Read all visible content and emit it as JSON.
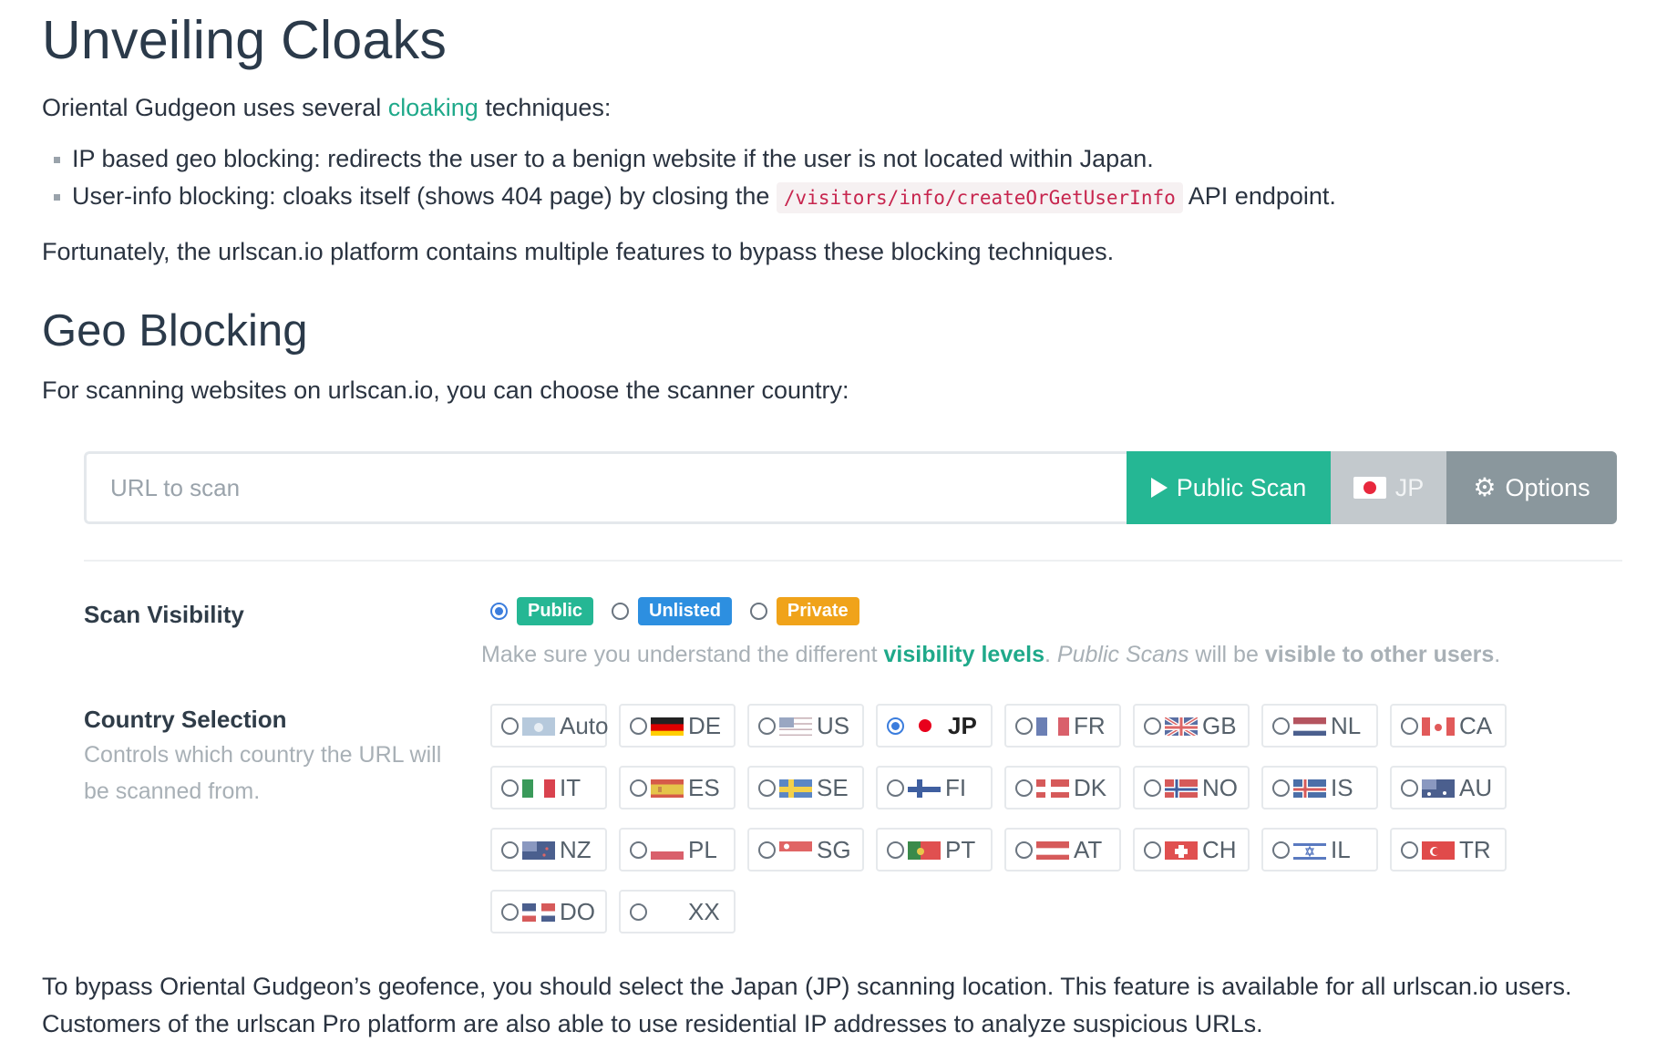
{
  "article": {
    "title": "Unveiling Cloaks",
    "intro_prefix": "Oriental Gudgeon uses several",
    "intro_link": "cloaking",
    "intro_suffix": "techniques:",
    "bullets": [
      {
        "text": "IP based geo blocking: redirects the user to a benign website if the user is not located within Japan."
      },
      {
        "prefix": "User-info blocking: cloaks itself (shows 404 page) by closing the",
        "code": "/visitors/info/createOrGetUserInfo",
        "suffix": "API endpoint."
      }
    ],
    "fortunately": "Fortunately, the urlscan.io platform contains multiple features to bypass these blocking techniques.",
    "section2_title": "Geo Blocking",
    "section2_intro": "For scanning websites on urlscan.io, you can choose the scanner country:",
    "closing_line1": "To bypass Oriental Gudgeon’s geofence, you should select the Japan (JP) scanning location. This feature is available for all urlscan.io users.",
    "closing_line2": "Customers of the urlscan Pro platform are also able to use residential IP addresses to analyze suspicious URLs."
  },
  "scanbar": {
    "placeholder": "URL to scan",
    "public_scan_label": "Public Scan",
    "country_label": "JP",
    "options_label": "Options",
    "icons": {
      "public_scan": "play-icon",
      "country": "jp-flag-icon",
      "options": "gear-icon"
    }
  },
  "visibility": {
    "label": "Scan Visibility",
    "options": [
      {
        "label": "Public",
        "selected": true,
        "color": "#25b794"
      },
      {
        "label": "Unlisted",
        "selected": false,
        "color": "#2d8fe0"
      },
      {
        "label": "Private",
        "selected": false,
        "color": "#f0a31a"
      }
    ],
    "note_prefix": "Make sure you understand the different",
    "note_link": "visibility levels",
    "note_mid": ".",
    "note_italic": "Public Scans",
    "note_rest": "will be",
    "note_bold": "visible to other users",
    "note_end": "."
  },
  "country": {
    "label": "Country Selection",
    "sublabel": "Controls which country the URL will be scanned from.",
    "selected": "JP",
    "options": [
      "Auto",
      "DE",
      "US",
      "JP",
      "FR",
      "GB",
      "NL",
      "CA",
      "IT",
      "ES",
      "SE",
      "FI",
      "DK",
      "NO",
      "IS",
      "AU",
      "NZ",
      "PL",
      "SG",
      "PT",
      "AT",
      "CH",
      "IL",
      "TR",
      "DO",
      "XX"
    ]
  },
  "colors": {
    "accent": "#25b794",
    "link": "#1fa98a",
    "code": "#c7254e"
  }
}
